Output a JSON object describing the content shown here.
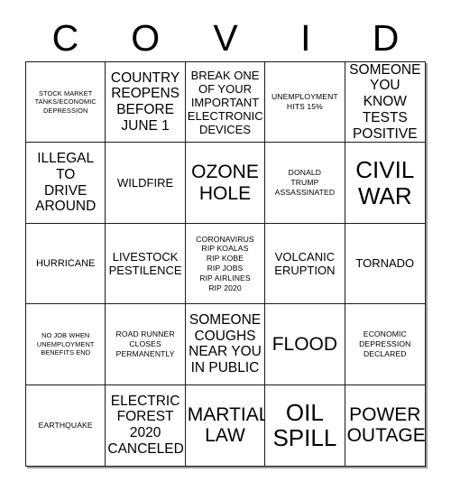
{
  "card": {
    "header": {
      "letters": [
        "C",
        "O",
        "V",
        "I",
        "D"
      ]
    },
    "rows": [
      [
        {
          "text": "STOCK MARKET\nTANKS/ECONOMIC\nDEPRESSION",
          "size": "xs"
        },
        {
          "text": "COUNTRY\nREOPENS\nBEFORE\nJUNE 1",
          "size": "l"
        },
        {
          "text": "BREAK ONE\nOF YOUR\nIMPORTANT\nELECTRONIC\nDEVICES",
          "size": "ml"
        },
        {
          "text": "UNEMPLOYMENT\nHITS 15%",
          "size": "s"
        },
        {
          "text": "SOMEONE\nYOU KNOW\nTESTS\nPOSITIVE",
          "size": "l"
        }
      ],
      [
        {
          "text": "ILLEGAL\nTO\nDRIVE\nAROUND",
          "size": "l"
        },
        {
          "text": "WILDFIRE",
          "size": "ml"
        },
        {
          "text": "OZONE\nHOLE",
          "size": "xl"
        },
        {
          "text": "DONALD\nTRUMP\nASSASSINATED",
          "size": "s"
        },
        {
          "text": "CIVIL\nWAR",
          "size": "xxl"
        }
      ],
      [
        {
          "text": "HURRICANE",
          "size": "m"
        },
        {
          "text": "LIVESTOCK\nPESTILENCE",
          "size": "ml"
        },
        {
          "text": "CORONAVIRUS\nRIP KOALAS\nRIP KOBE\nRIP JOBS\nRIP AIRLINES\nRIP 2020",
          "size": "s"
        },
        {
          "text": "VOLCANIC\nERUPTION",
          "size": "ml"
        },
        {
          "text": "TORNADO",
          "size": "ml"
        }
      ],
      [
        {
          "text": "NO JOB WHEN\nUNEMPLOYMENT\nBENEFITS END",
          "size": "xs"
        },
        {
          "text": "ROAD RUNNER\nCLOSES\nPERMANENTLY",
          "size": "s"
        },
        {
          "text": "SOMEONE\nCOUGHS\nNEAR YOU\nIN PUBLIC",
          "size": "l"
        },
        {
          "text": "FLOOD",
          "size": "xl"
        },
        {
          "text": "ECONOMIC\nDEPRESSION\nDECLARED",
          "size": "s"
        }
      ],
      [
        {
          "text": "EARTHQUAKE",
          "size": "s"
        },
        {
          "text": "ELECTRIC\nFOREST\n2020\nCANCELED",
          "size": "l"
        },
        {
          "text": "MARTIAL\nLAW",
          "size": "xl"
        },
        {
          "text": "OIL\nSPILL",
          "size": "xxl"
        },
        {
          "text": "POWER\nOUTAGE",
          "size": "xl"
        }
      ]
    ]
  }
}
